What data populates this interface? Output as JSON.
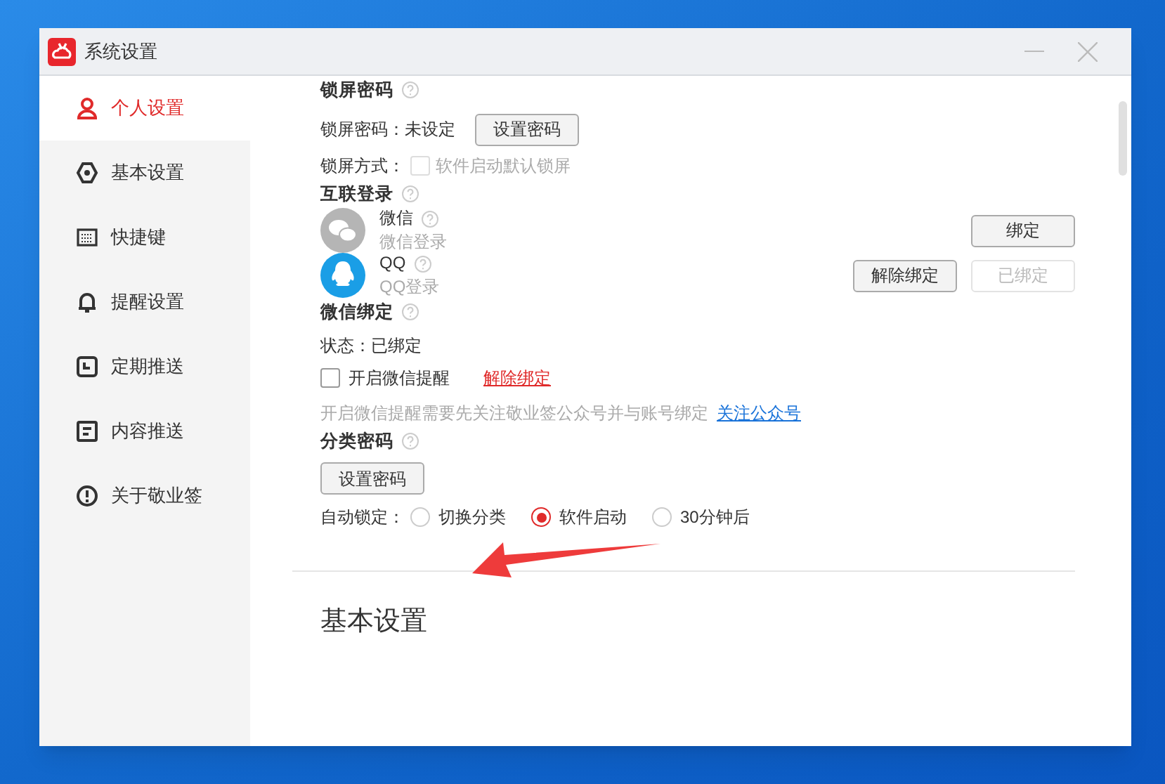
{
  "window": {
    "title": "系统设置"
  },
  "sidebar": {
    "items": [
      {
        "label": "个人设置",
        "selected": true
      },
      {
        "label": "基本设置",
        "selected": false
      },
      {
        "label": "快捷键",
        "selected": false
      },
      {
        "label": "提醒设置",
        "selected": false
      },
      {
        "label": "定期推送",
        "selected": false
      },
      {
        "label": "内容推送",
        "selected": false
      },
      {
        "label": "关于敬业签",
        "selected": false
      }
    ]
  },
  "lock_password": {
    "title": "锁屏密码",
    "label": "锁屏密码：",
    "value": "未设定",
    "button": "设置密码",
    "mode_label": "锁屏方式：",
    "mode_option": {
      "label": "软件启动默认锁屏",
      "checked": false,
      "disabled": true
    }
  },
  "linked_login": {
    "title": "互联登录",
    "accounts": [
      {
        "kind": "wechat",
        "name": "微信",
        "subtitle": "微信登录",
        "buttons": [
          {
            "label": "绑定",
            "disabled": false
          }
        ]
      },
      {
        "kind": "qq",
        "name": "QQ",
        "subtitle": "QQ登录",
        "buttons": [
          {
            "label": "解除绑定",
            "disabled": false
          },
          {
            "label": "已绑定",
            "disabled": true
          }
        ]
      }
    ]
  },
  "wechat_binding": {
    "title": "微信绑定",
    "status_label": "状态：",
    "status": "已绑定",
    "reminder": {
      "label": "开启微信提醒",
      "checked": false
    },
    "unbind_link": "解除绑定",
    "hint": "开启微信提醒需要先关注敬业签公众号并与账号绑定",
    "follow_link": "关注公众号"
  },
  "category_password": {
    "title": "分类密码",
    "button": "设置密码",
    "auto_lock_label": "自动锁定：",
    "options": [
      {
        "label": "切换分类",
        "selected": false
      },
      {
        "label": "软件启动",
        "selected": true
      },
      {
        "label": "30分钟后",
        "selected": false
      }
    ]
  },
  "next_section": {
    "title": "基本设置"
  }
}
